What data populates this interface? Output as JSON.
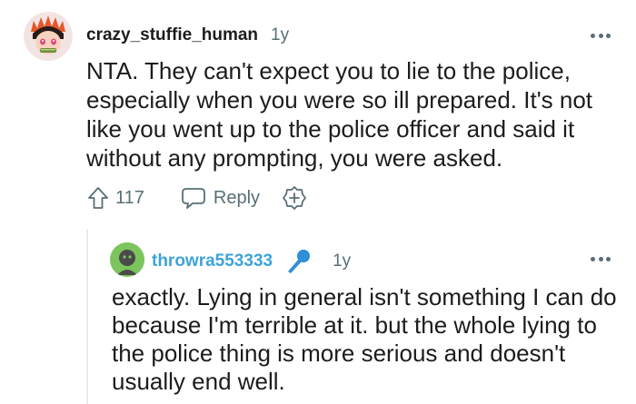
{
  "comment": {
    "username": "crazy_stuffie_human",
    "age": "1y",
    "body": "NTA. They can't expect you to lie to the police, especially when you were so ill prepared. It's not like you went up to the police officer and said it without any prompting, you were asked.",
    "score": "117",
    "reply_label": "Reply",
    "icons": {
      "upvote": "upvote-arrow-icon",
      "reply": "speech-bubble-icon",
      "award": "award-plus-icon",
      "more": "more-options-icon"
    }
  },
  "reply": {
    "username": "throwra553333",
    "age": "1y",
    "body": "exactly. Lying in general isn't something I can do because I'm terrible at it. but the whole lying to the police thing is more serious and doesn't usually end well.",
    "icons": {
      "flair": "microphone-icon",
      "more": "more-options-icon"
    }
  },
  "colors": {
    "text": "#1c1c1c",
    "meta": "#576f76",
    "reply_username": "#3da4d8",
    "thread_line": "#e5ebee",
    "reply_avatar": "#7cc55d"
  }
}
